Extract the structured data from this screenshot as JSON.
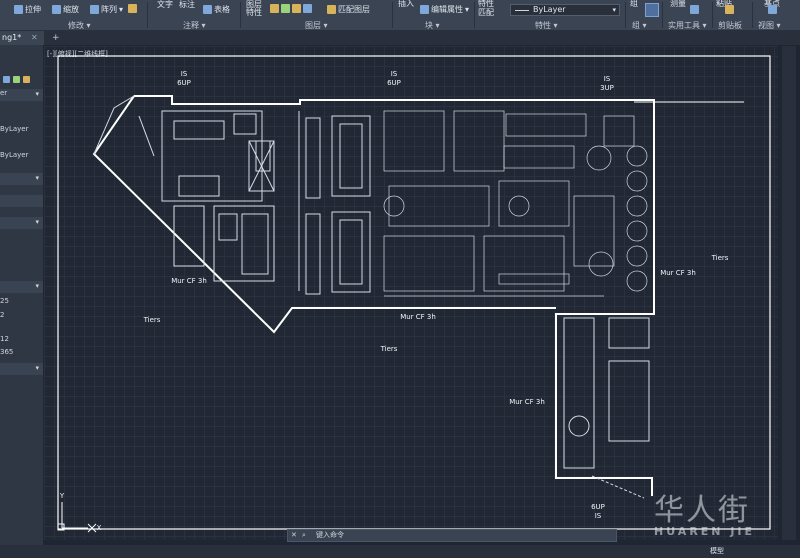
{
  "ribbon": {
    "stretch": "拉伸",
    "scale": "缩放",
    "array": "阵列",
    "text": "文字",
    "dimension": "标注",
    "table": "表格",
    "layer_properties": "图层特性",
    "match_layer": "匹配图层",
    "insert": "插入",
    "edit_attributes": "编辑属性",
    "match_properties": "特性匹配",
    "layer_combo_value": "ByLayer",
    "group": "组",
    "measure": "测量",
    "paste": "粘贴",
    "base": "基点",
    "panels": {
      "modify": "修改",
      "annotation": "注释",
      "layers": "图层",
      "block": "块",
      "properties": "特性",
      "groups": "组",
      "utilities": "实用工具",
      "clipboard": "剪贴板",
      "view": "视图"
    }
  },
  "tabs": [
    {
      "label": "ng1*"
    }
  ],
  "left_panel": {
    "rows": [
      "er",
      "ByLayer",
      "ByLayer",
      "25",
      "2",
      "12",
      "365"
    ]
  },
  "viewport": {
    "label": "[-][俯视][二维线框]",
    "annotations": [
      {
        "id": "is-6up-left",
        "top": "IS",
        "bottom": "6UP"
      },
      {
        "id": "is-6up-center",
        "top": "IS",
        "bottom": "6UP"
      },
      {
        "id": "is-3up",
        "top": "IS",
        "bottom": "3UP"
      },
      {
        "id": "6up-is-bottom",
        "top": "6UP",
        "bottom": "IS"
      }
    ],
    "walls": [
      "Mur CF 3h",
      "Mur CF 3h",
      "Mur CF 3h",
      "Mur CF 3h"
    ],
    "tiers": [
      "Tiers",
      "Tiers",
      "Tiers"
    ],
    "axis": {
      "y": "Y",
      "x": "X"
    }
  },
  "command": {
    "prompt": "键入命令"
  },
  "status": {
    "model": "模型"
  },
  "watermark": {
    "han": "华人街",
    "latin": "HUAREN JIE"
  }
}
